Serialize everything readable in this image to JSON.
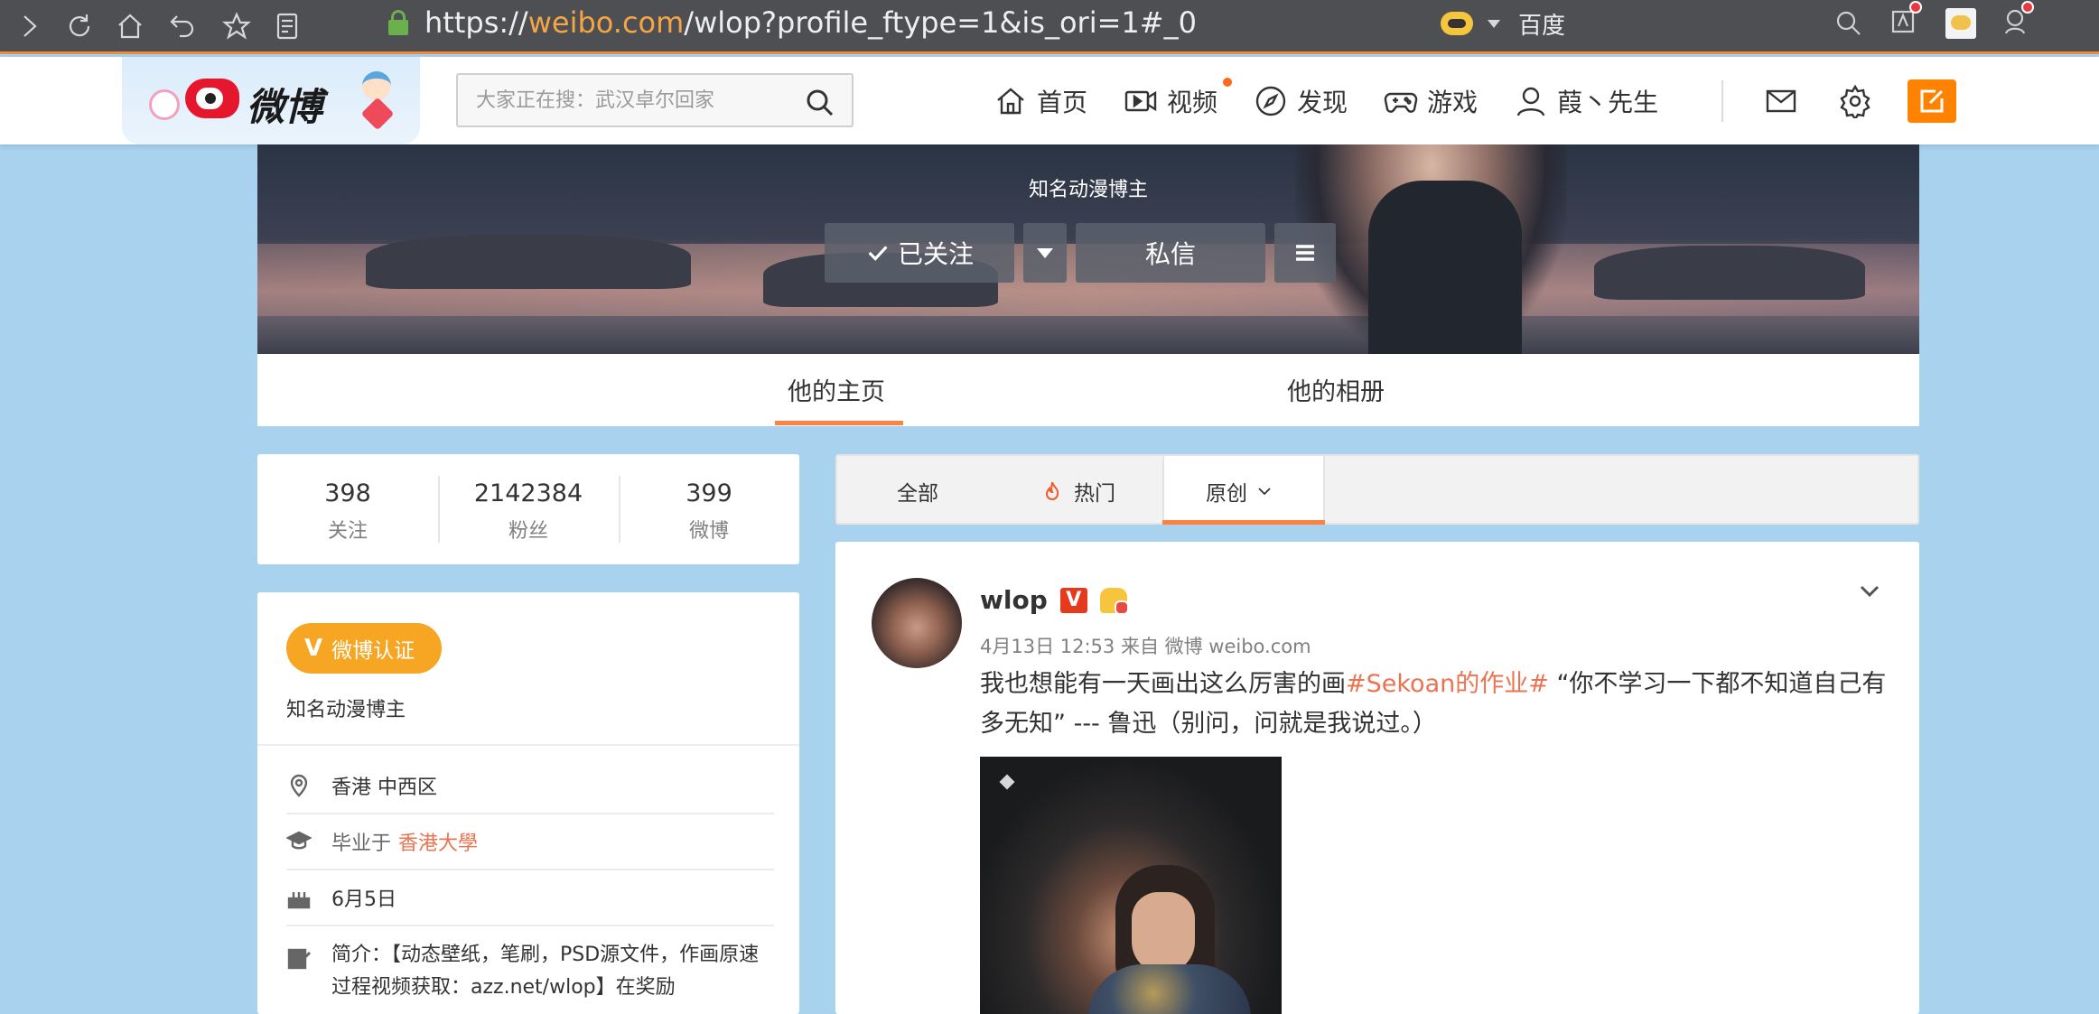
{
  "browser": {
    "url_prefix": "https://",
    "url_domain": "weibo.com",
    "url_path": "/wlop?profile_ftype=1&is_ori=1#_0",
    "search_engine": "百度"
  },
  "nav": {
    "logo_text": "微博",
    "search_placeholder": "大家正在搜：武汉卓尔回家",
    "items": [
      {
        "label": "首页",
        "icon": "home-icon"
      },
      {
        "label": "视频",
        "icon": "video-icon"
      },
      {
        "label": "发现",
        "icon": "compass-icon"
      },
      {
        "label": "游戏",
        "icon": "gamepad-icon"
      },
      {
        "label": "葭丶先生",
        "icon": "user-icon"
      }
    ]
  },
  "cover": {
    "verified_title": "知名动漫博主",
    "follow_label": "已关注",
    "message_label": "私信"
  },
  "profile_tabs": [
    "他的主页",
    "他的相册"
  ],
  "stats": [
    {
      "num": "398",
      "label": "关注"
    },
    {
      "num": "2142384",
      "label": "粉丝"
    },
    {
      "num": "399",
      "label": "微博"
    }
  ],
  "about": {
    "verify_badge": "微博认证",
    "verify_text": "知名动漫博主",
    "location": "香港 中西区",
    "edu_prefix": "毕业于",
    "edu_school": "香港大學",
    "birthday": "6月5日",
    "bio": "简介：【动态壁纸，笔刷，PSD源文件，作画原速过程视频获取：azz.net/wlop】在奖励"
  },
  "feed_filter": {
    "all": "全部",
    "hot": "热门",
    "original": "原创"
  },
  "post": {
    "author": "wlop",
    "meta": "4月13日 12:53 来自 微博 weibo.com",
    "text_before": "我也想能有一天画出这么厉害的画",
    "hashtag": "#Sekoan的作业#",
    "text_after": " “你不学习一下都不知道自己有多无知” --- 鲁迅（别问，问就是我说过。）"
  },
  "colors": {
    "accent_orange": "#ff8200",
    "link_orange": "#eb7350",
    "weibo_red": "#e6162d",
    "page_bg": "#a8d2ee",
    "verify_gold": "#f6a623"
  }
}
